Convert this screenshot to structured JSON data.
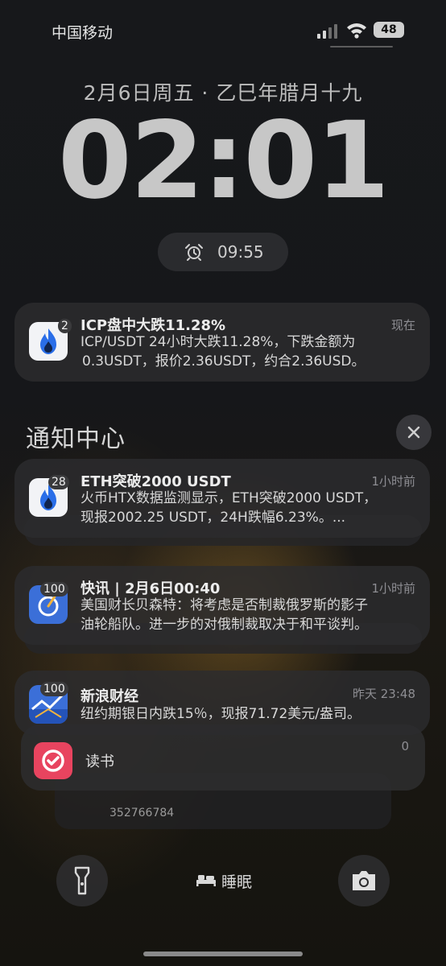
{
  "status_bar": {
    "carrier": "中国移动",
    "battery": "48"
  },
  "lock": {
    "date": "2月6日周五 · 乙巳年腊月十九",
    "time": "02:01",
    "alarm": "09:55"
  },
  "pinned": {
    "title": "ICP盘中大跌11.28%",
    "when": "现在",
    "badge": "2",
    "line1": "ICP/USDT 24小时大跌11.28%，下跌金额为",
    "line2": "0.3USDT，报价2.36USDT，约合2.36USD。"
  },
  "notification_center": {
    "title": "通知中心",
    "items": [
      {
        "title": "ETH突破2000  USDT",
        "when": "1小时前",
        "badge": "28",
        "line1": "火币HTX数据监测显示，ETH突破2000  USDT，",
        "line2": "现报2002.25 USDT，24H跌幅6.23%。..."
      },
      {
        "title": "快讯 | 2月6日00:40",
        "when": "1小时前",
        "badge": "100",
        "line1": "美国财长贝森特：将考虑是否制裁俄罗斯的影子",
        "line2": "油轮船队。进一步的对俄制裁取决于和平谈判。"
      },
      {
        "title": "新浪财经",
        "when": "昨天 23:48",
        "badge": "100",
        "line1": "纽约期银日内跌15％，现报71.72美元/盎司。"
      }
    ],
    "stacked": {
      "title": "读书",
      "when_partial": "0",
      "extra_text": "352766784"
    }
  },
  "bottom": {
    "sleep_label": "睡眠"
  },
  "colors": {
    "huobi_blue": "#2a6ee8",
    "reading_red": "#e8445f",
    "news_blue": "#3b6fd8"
  }
}
